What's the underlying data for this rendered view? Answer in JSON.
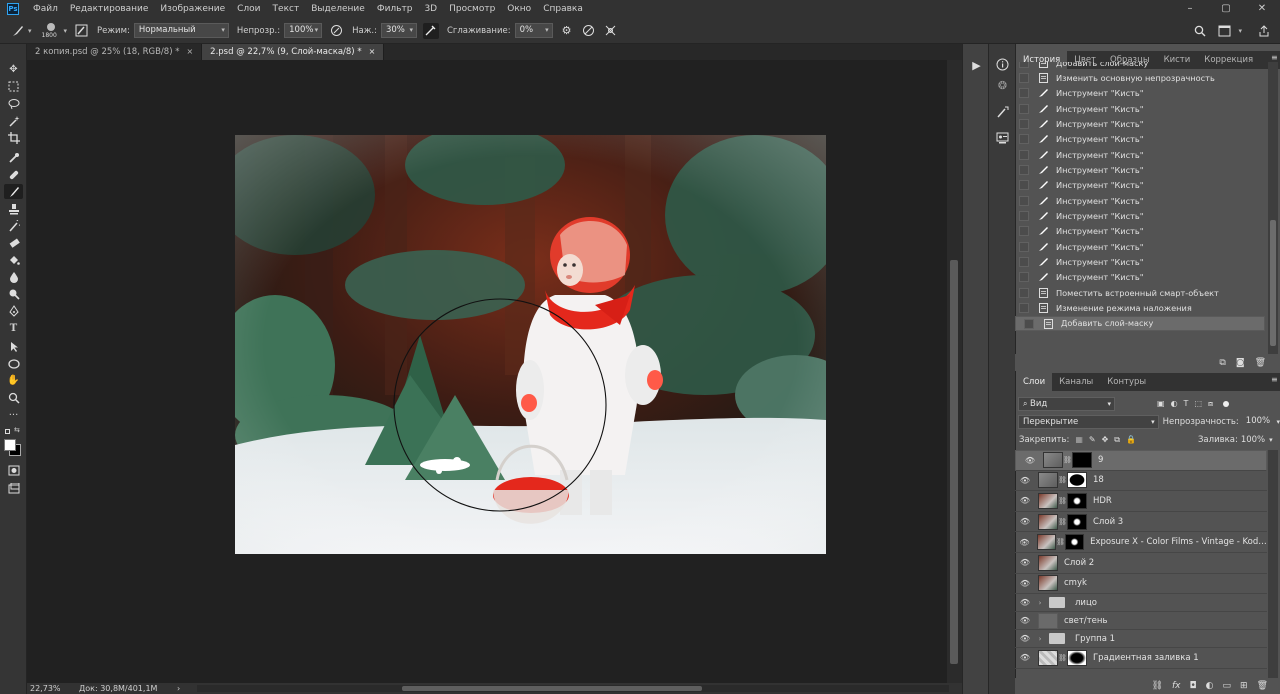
{
  "menu": {
    "app_icon": "Ps",
    "items": [
      "Файл",
      "Редактирование",
      "Изображение",
      "Слои",
      "Текст",
      "Выделение",
      "Фильтр",
      "3D",
      "Просмотр",
      "Окно",
      "Справка"
    ]
  },
  "options": {
    "brush_size": "1800",
    "mode_label": "Режим:",
    "mode_value": "Нормальный",
    "opacity_label": "Непрозр.:",
    "opacity_value": "100%",
    "pressure_label": "Наж.:",
    "pressure_value": "30%",
    "smoothing_label": "Сглаживание:",
    "smoothing_value": "0%"
  },
  "tabs": [
    {
      "label": "2 копия.psd @ 25% (18, RGB/8) *",
      "close": "×"
    },
    {
      "label": "2.psd @ 22,7% (9, Слой-маска/8) *",
      "close": "×"
    }
  ],
  "status": {
    "zoom": "22,73%",
    "doc": "Док: 30,8M/401,1M",
    "arrow": "›"
  },
  "history_panel": {
    "tabs": [
      "История",
      "Цвет",
      "Образцы",
      "Кисти",
      "Коррекция"
    ],
    "items": [
      {
        "label": "Добавить слой-маску",
        "icon": "doc"
      },
      {
        "label": "Изменить основную непрозрачность",
        "icon": "doc"
      },
      {
        "label": "Инструмент \"Кисть\"",
        "icon": "brush"
      },
      {
        "label": "Инструмент \"Кисть\"",
        "icon": "brush"
      },
      {
        "label": "Инструмент \"Кисть\"",
        "icon": "brush"
      },
      {
        "label": "Инструмент \"Кисть\"",
        "icon": "brush"
      },
      {
        "label": "Инструмент \"Кисть\"",
        "icon": "brush"
      },
      {
        "label": "Инструмент \"Кисть\"",
        "icon": "brush"
      },
      {
        "label": "Инструмент \"Кисть\"",
        "icon": "brush"
      },
      {
        "label": "Инструмент \"Кисть\"",
        "icon": "brush"
      },
      {
        "label": "Инструмент \"Кисть\"",
        "icon": "brush"
      },
      {
        "label": "Инструмент \"Кисть\"",
        "icon": "brush"
      },
      {
        "label": "Инструмент \"Кисть\"",
        "icon": "brush"
      },
      {
        "label": "Инструмент \"Кисть\"",
        "icon": "brush"
      },
      {
        "label": "Инструмент \"Кисть\"",
        "icon": "brush"
      },
      {
        "label": "Поместить встроенный смарт-объект",
        "icon": "doc"
      },
      {
        "label": "Изменение режима наложения",
        "icon": "doc"
      },
      {
        "label": "Добавить слой-маску",
        "icon": "doc",
        "selected": true
      }
    ]
  },
  "layers_panel": {
    "tabs": [
      "Слои",
      "Каналы",
      "Контуры"
    ],
    "filter_value": "Вид",
    "blend_value": "Перекрытие",
    "opacity_label": "Непрозрачность:",
    "opacity_value": "100%",
    "lock_label": "Закрепить:",
    "fill_label": "Заливка:",
    "fill_value": "100%",
    "layers": [
      {
        "name": "9",
        "type": "smart-mask",
        "selected": true
      },
      {
        "name": "18",
        "type": "smart-mask"
      },
      {
        "name": "HDR",
        "type": "mask"
      },
      {
        "name": "Слой 3",
        "type": "mask"
      },
      {
        "name": "Exposure X - Color Films - Vintage - Kodac...",
        "type": "mask"
      },
      {
        "name": "Слой 2",
        "type": "pixel"
      },
      {
        "name": "cmyk",
        "type": "pixel"
      },
      {
        "name": "лицо",
        "type": "group"
      },
      {
        "name": "свет/тень",
        "type": "plain"
      },
      {
        "name": "Группа 1",
        "type": "group"
      },
      {
        "name": "Градиентная заливка 1",
        "type": "gradient"
      }
    ]
  },
  "colors": {
    "accent": "#31a8ff",
    "selected_row": "#6b6b6b",
    "scarf_red": "#e4281c"
  }
}
